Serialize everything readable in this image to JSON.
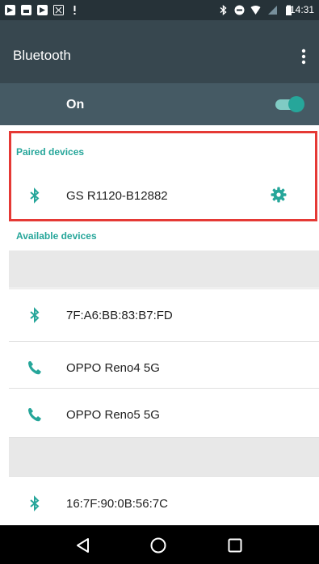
{
  "status_bar": {
    "time": "14:31",
    "icons_left": [
      "notification-icon",
      "message-icon",
      "notification-icon",
      "sim-icon",
      "alert-icon"
    ],
    "icons_right": [
      "bluetooth-icon",
      "do-not-disturb-icon",
      "wifi-icon",
      "signal-icon",
      "battery-icon"
    ]
  },
  "app_bar": {
    "title": "Bluetooth",
    "menu_icon": "more-vert-icon"
  },
  "toggle": {
    "label": "On",
    "state": "on",
    "accent": "#26a69a"
  },
  "paired": {
    "header": "Paired devices",
    "devices": [
      {
        "name": "GS R1120-B12882",
        "icon": "bluetooth-icon",
        "settings_icon": "gear-icon"
      }
    ]
  },
  "available": {
    "header": "Available devices",
    "devices": [
      {
        "name": "7F:A6:BB:83:B7:FD",
        "icon": "bluetooth-icon"
      },
      {
        "name": "OPPO Reno4 5G",
        "icon": "phone-icon"
      },
      {
        "name": "OPPO Reno5 5G",
        "icon": "phone-icon"
      },
      {
        "name": "16:7F:90:0B:56:7C",
        "icon": "bluetooth-icon"
      }
    ]
  },
  "nav_bar": {
    "icons": [
      "back-icon",
      "home-icon",
      "recents-icon"
    ]
  },
  "colors": {
    "status_bar": "#263238",
    "app_bar": "#37474f",
    "toggle_bar": "#455a64",
    "accent": "#26a69a",
    "highlight_box": "#e53935"
  }
}
